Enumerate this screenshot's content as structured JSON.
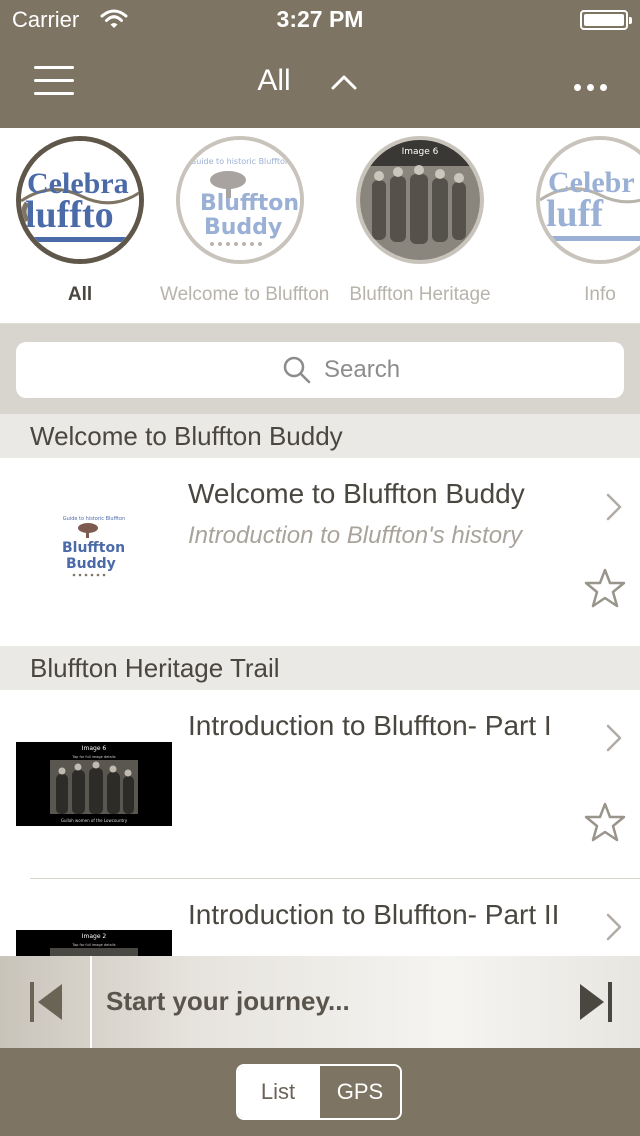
{
  "status_bar": {
    "carrier": "Carrier",
    "time": "3:27 PM"
  },
  "nav": {
    "title": "All"
  },
  "categories": [
    {
      "label": "All",
      "logo_text_1": "Celebra",
      "logo_text_2": "luffto"
    },
    {
      "label": "Welcome to Bluffton",
      "logo_text_1": "Bluffton",
      "logo_text_2": "Buddy",
      "logo_arc": "Guide to historic Bluffton"
    },
    {
      "label": "Bluffton Heritage",
      "logo_text_1": "Image 6"
    },
    {
      "label": "Info",
      "logo_text_1": "Celebr",
      "logo_text_2": "luff"
    }
  ],
  "search": {
    "placeholder": "Search"
  },
  "sections": [
    {
      "header": "Welcome to Bluffton Buddy",
      "rows": [
        {
          "title": "Welcome to Bluffton Buddy",
          "subtitle": "Introduction to Bluffton's history",
          "thumb_text_1": "Bluffton",
          "thumb_text_2": "Buddy",
          "thumb_arc": "Guide to historic Bluffton"
        }
      ]
    },
    {
      "header": "Bluffton Heritage Trail",
      "rows": [
        {
          "title": "Introduction to Bluffton- Part I",
          "thumb_caption": "Image 6",
          "thumb_subcaption": "Tap for full image details",
          "thumb_footer": "Gullah women of the Lowcountry"
        },
        {
          "title": "Introduction to Bluffton- Part II",
          "thumb_caption": "Image 2",
          "thumb_subcaption": "Tap for full image details"
        }
      ]
    }
  ],
  "player": {
    "text": "Start your journey..."
  },
  "bottom_toolbar": {
    "list_label": "List",
    "gps_label": "GPS"
  },
  "colors": {
    "brand": "#7d7463",
    "text": "#4a4640",
    "muted": "#a8a39b",
    "logo_blue": "#4b6aa8"
  }
}
